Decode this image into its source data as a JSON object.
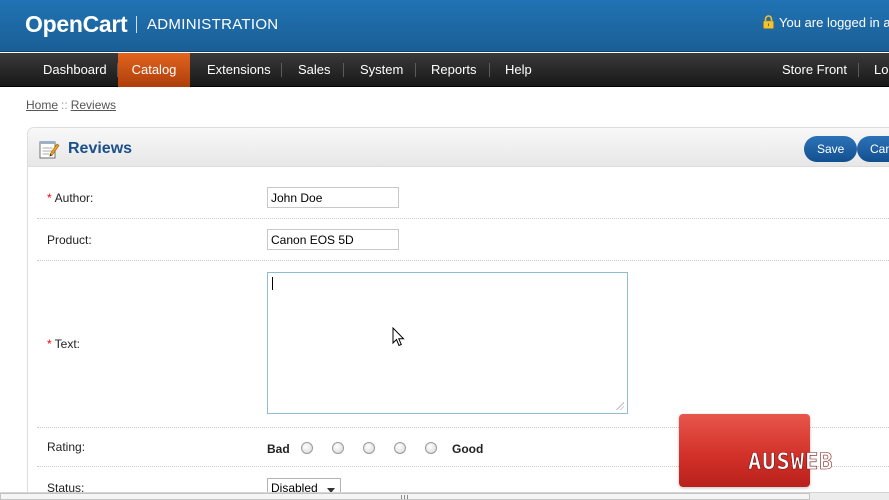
{
  "header": {
    "logo": "OpenCart",
    "subtitle": "ADMINISTRATION",
    "login_text": "You are logged in as"
  },
  "menu": {
    "items": [
      {
        "label": "Dashboard"
      },
      {
        "label": "Catalog",
        "active": true
      },
      {
        "label": "Extensions"
      },
      {
        "label": "Sales"
      },
      {
        "label": "System"
      },
      {
        "label": "Reports"
      },
      {
        "label": "Help"
      }
    ],
    "right_items": [
      {
        "label": "Store Front"
      },
      {
        "label": "Lo"
      }
    ]
  },
  "breadcrumb": {
    "home": "Home",
    "separator": "::",
    "current": "Reviews"
  },
  "box": {
    "title": "Reviews",
    "save_label": "Save",
    "cancel_label": "Can"
  },
  "form": {
    "author": {
      "label": "Author:",
      "required": "*",
      "value": "John Doe"
    },
    "product": {
      "label": "Product:",
      "value": "Canon EOS 5D"
    },
    "text": {
      "label": "Text:",
      "required": "*",
      "value": ""
    },
    "rating": {
      "label": "Rating:",
      "low": "Bad",
      "high": "Good",
      "options": 5
    },
    "status": {
      "label": "Status:",
      "value": "Disabled"
    }
  },
  "colors": {
    "header_blue": "#1a5f96",
    "active_tab": "#d25417",
    "title_blue": "#1b4f8c",
    "button_blue": "#124f8f",
    "required_red": "#ff0000",
    "watermark_red": "#d3322a"
  },
  "icons": {
    "lock": "lock-icon",
    "reviews": "notepad-pencil-icon",
    "cursor": "mouse-pointer-icon",
    "watermark": "ausweb-logo"
  },
  "watermark": {
    "text": "AUSWEB"
  }
}
